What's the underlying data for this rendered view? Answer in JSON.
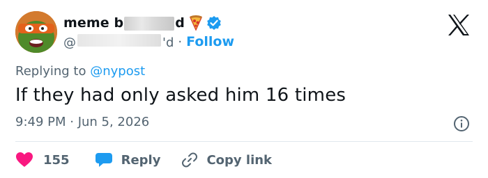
{
  "user": {
    "name_start": "meme b",
    "name_end": "d",
    "handle_start": "@",
    "handle_end": "'d",
    "dot": "·",
    "follow_label": "Follow"
  },
  "tweet": {
    "replying_prefix": "Replying to ",
    "replying_handle": "@nypost",
    "text": "If they had only asked him 16 times",
    "timestamp": "9:49 PM · Jun 5, 2026"
  },
  "actions": {
    "like_count": "155",
    "reply_label": "Reply",
    "copy_label": "Copy link"
  },
  "colors": {
    "accent": "#1d9bf0",
    "like": "#f91880",
    "secondary_text": "#536471",
    "primary_text": "#0f1419"
  },
  "icons": {
    "avatar": "ninja-turtle-avatar",
    "emoji": "pizza-emoji",
    "verified": "verified-badge-icon",
    "brand": "x-logo",
    "info": "info-icon",
    "like": "heart-icon",
    "reply": "speech-bubble-icon",
    "copy": "link-icon"
  }
}
